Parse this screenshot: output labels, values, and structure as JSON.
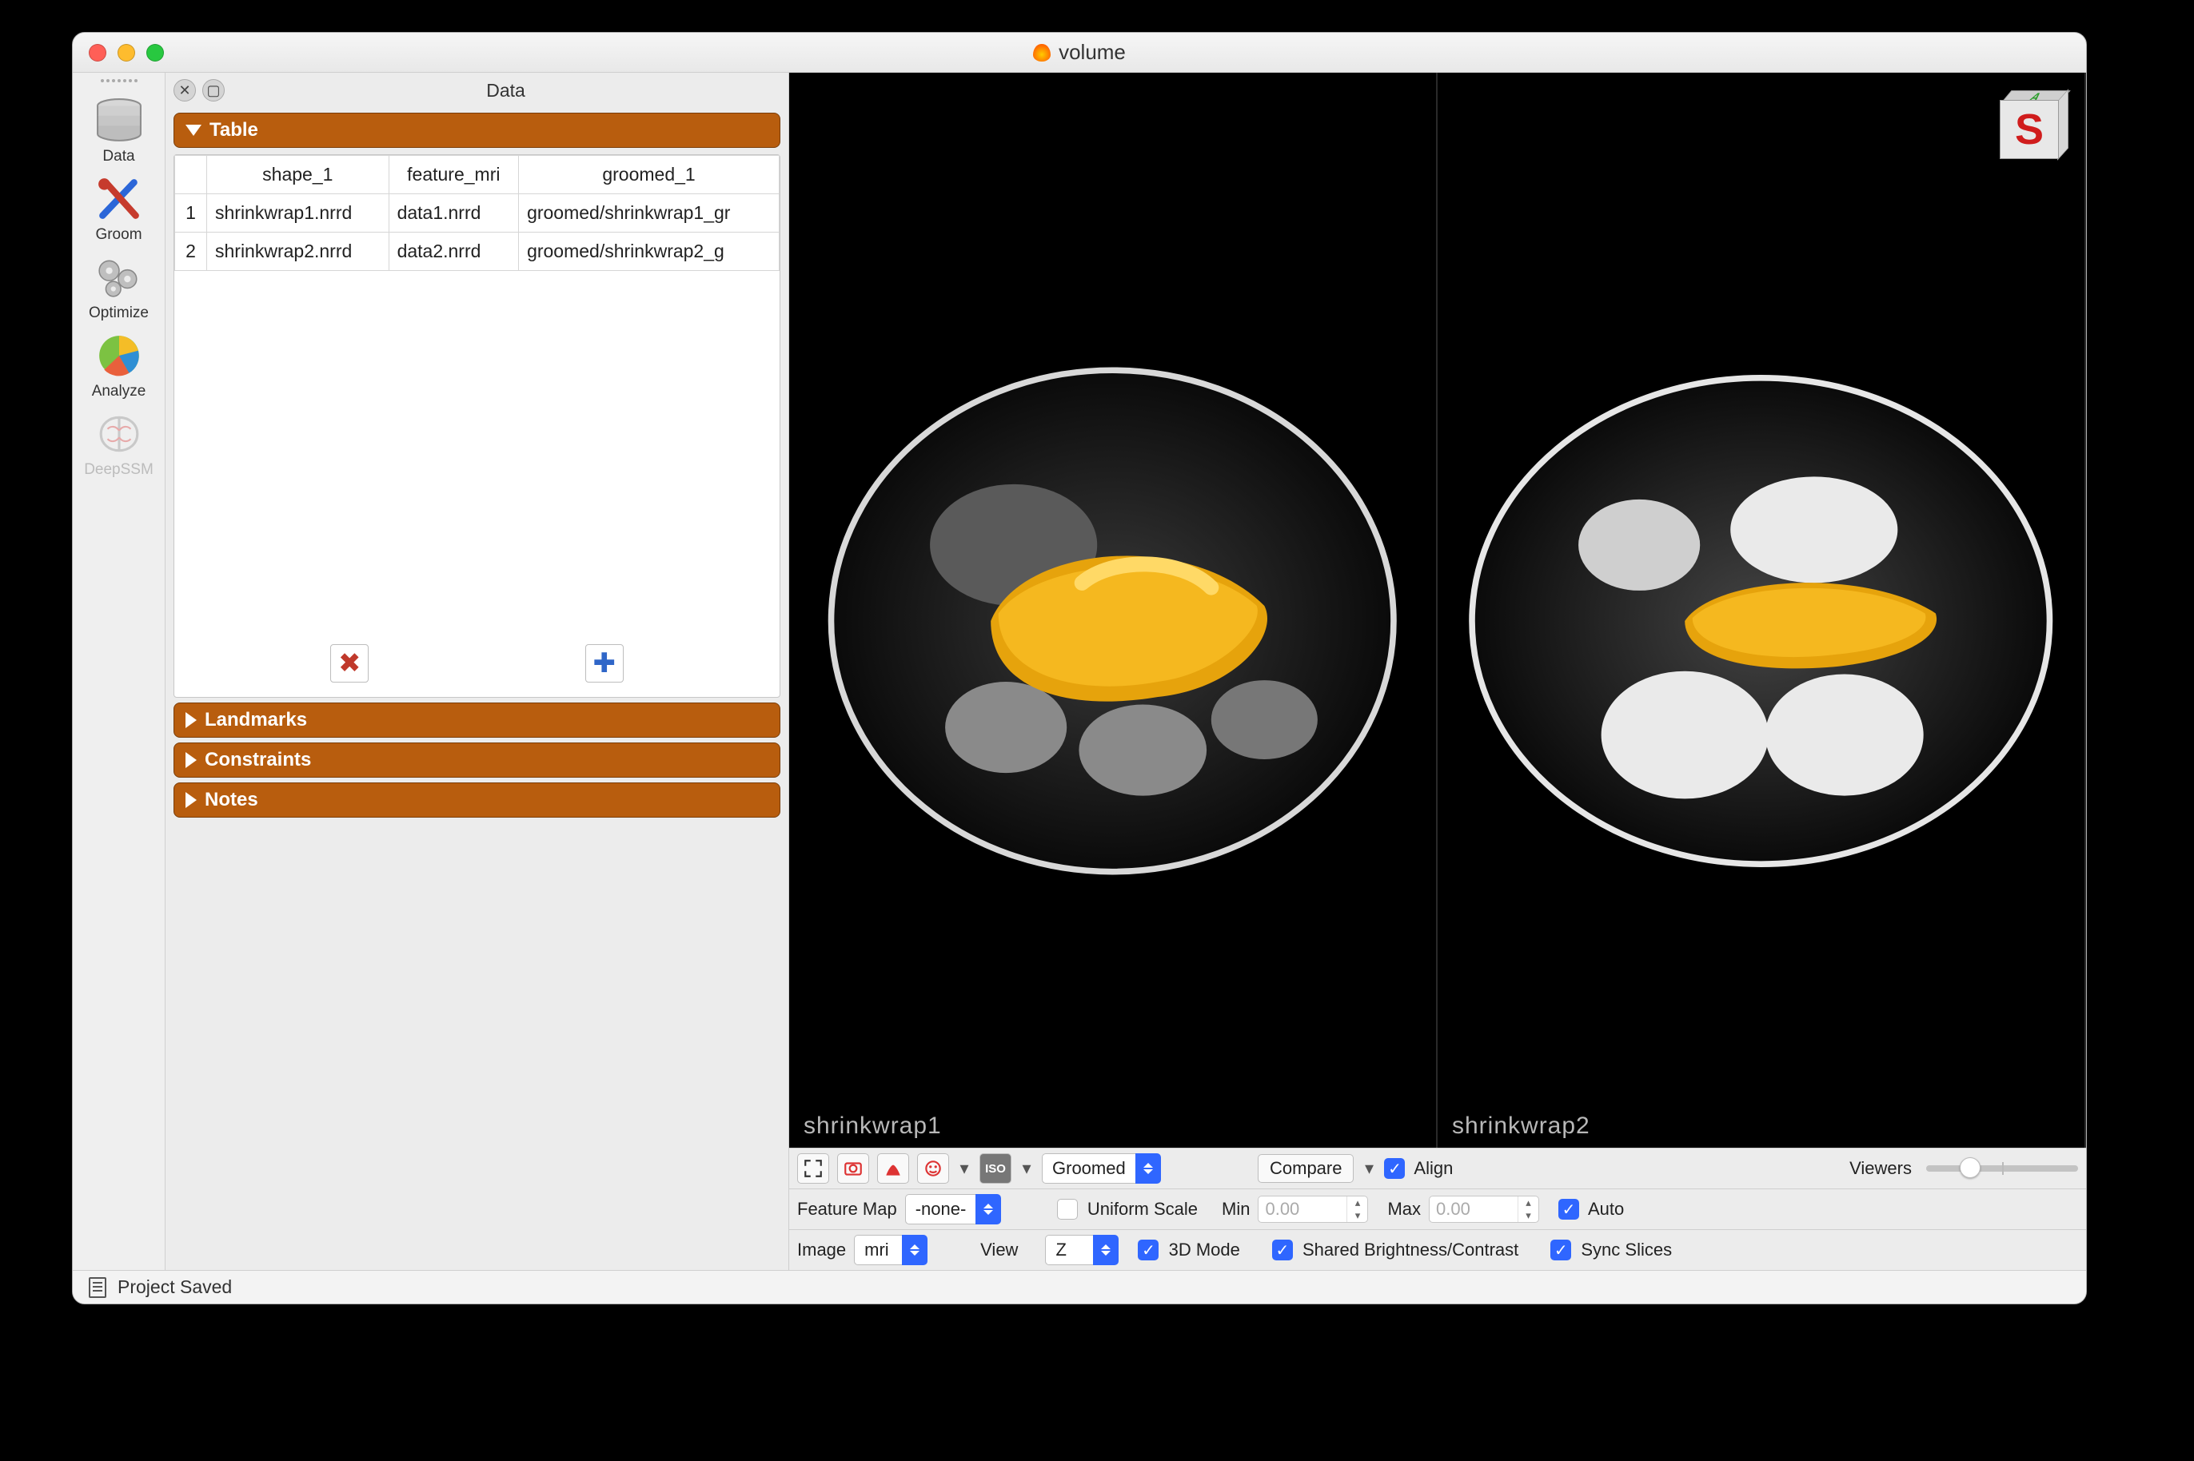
{
  "window": {
    "title": "volume"
  },
  "sidebar": {
    "items": [
      {
        "label": "Data",
        "active": true
      },
      {
        "label": "Groom",
        "active": false
      },
      {
        "label": "Optimize",
        "active": false
      },
      {
        "label": "Analyze",
        "active": false
      },
      {
        "label": "DeepSSM",
        "active": false,
        "disabled": true
      }
    ]
  },
  "panel": {
    "label": "Data",
    "sections": {
      "table": "Table",
      "landmarks": "Landmarks",
      "constraints": "Constraints",
      "notes": "Notes"
    }
  },
  "table": {
    "columns": [
      "shape_1",
      "feature_mri",
      "groomed_1"
    ],
    "rows": [
      {
        "n": "1",
        "shape_1": "shrinkwrap1.nrrd",
        "feature_mri": "data1.nrrd",
        "groomed_1": "groomed/shrinkwrap1_gr"
      },
      {
        "n": "2",
        "shape_1": "shrinkwrap2.nrrd",
        "feature_mri": "data2.nrrd",
        "groomed_1": "groomed/shrinkwrap2_g"
      }
    ]
  },
  "render": {
    "views": [
      {
        "caption": "shrinkwrap1"
      },
      {
        "caption": "shrinkwrap2"
      }
    ],
    "cube": {
      "front": "S",
      "top": "A"
    }
  },
  "toolbar1": {
    "view_select": "Groomed",
    "compare": "Compare",
    "align": "Align",
    "viewers_label": "Viewers"
  },
  "toolbar2": {
    "feature_map_label": "Feature Map",
    "feature_map_value": "-none-",
    "uniform_scale": "Uniform Scale",
    "min_label": "Min",
    "min_value": "0.00",
    "max_label": "Max",
    "max_value": "0.00",
    "auto": "Auto"
  },
  "toolbar3": {
    "image_label": "Image",
    "image_value": "mri",
    "view_label": "View",
    "view_value": "Z",
    "mode3d": "3D Mode",
    "shared_bc": "Shared Brightness/Contrast",
    "sync_slices": "Sync Slices"
  },
  "status": {
    "text": "Project Saved"
  }
}
